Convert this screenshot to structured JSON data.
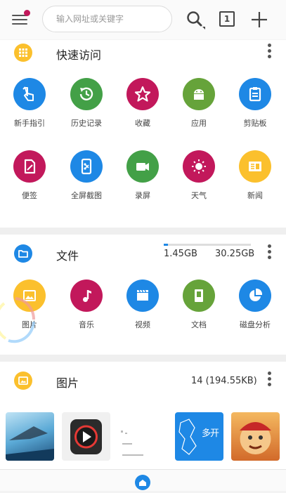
{
  "toolbar": {
    "search_placeholder": "输入网址或关键字",
    "tab_count": "1"
  },
  "quick_access": {
    "title": "快速访问",
    "items": [
      {
        "label": "新手指引",
        "color": "#1e88e5",
        "icon": "hand-pointer-icon"
      },
      {
        "label": "历史记录",
        "color": "#43a047",
        "icon": "history-icon"
      },
      {
        "label": "收藏",
        "color": "#c2185b",
        "icon": "star-icon"
      },
      {
        "label": "应用",
        "color": "#66a33a",
        "icon": "android-icon"
      },
      {
        "label": "剪贴板",
        "color": "#1e88e5",
        "icon": "clipboard-icon"
      },
      {
        "label": "便签",
        "color": "#c2185b",
        "icon": "note-icon"
      },
      {
        "label": "全屏截图",
        "color": "#1e88e5",
        "icon": "screenshot-icon"
      },
      {
        "label": "录屏",
        "color": "#43a047",
        "icon": "video-camera-icon"
      },
      {
        "label": "天气",
        "color": "#c2185b",
        "icon": "sun-icon"
      },
      {
        "label": "新闻",
        "color": "#fbc02d",
        "icon": "newspaper-icon"
      }
    ]
  },
  "files": {
    "title": "文件",
    "used": "1.45GB",
    "total": "30.25GB",
    "used_fraction": 0.048,
    "items": [
      {
        "label": "图片",
        "color": "#fbc02d",
        "icon": "image-icon"
      },
      {
        "label": "音乐",
        "color": "#c2185b",
        "icon": "music-note-icon"
      },
      {
        "label": "视频",
        "color": "#1e88e5",
        "icon": "clapperboard-icon"
      },
      {
        "label": "文档",
        "color": "#66a33a",
        "icon": "document-icon"
      },
      {
        "label": "磁盘分析",
        "color": "#1e88e5",
        "icon": "pie-chart-icon"
      }
    ]
  },
  "pictures": {
    "title": "图片",
    "summary": "14 (194.55KB)"
  }
}
